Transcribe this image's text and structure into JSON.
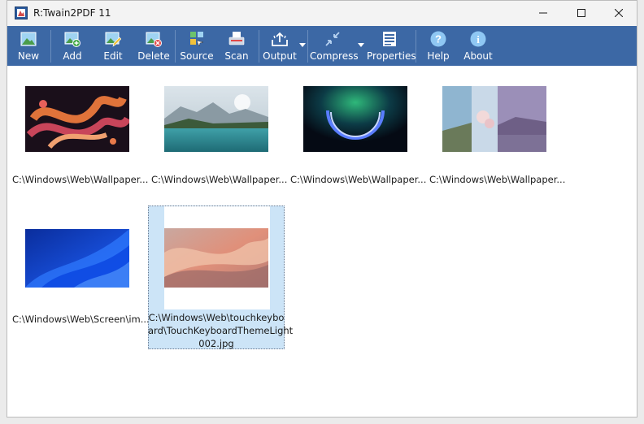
{
  "window": {
    "title": "R:Twain2PDF 11"
  },
  "titlebar_buttons": [
    "minimize",
    "maximize",
    "close"
  ],
  "toolbar": {
    "buttons": [
      {
        "label": "New",
        "icon": "new-image-icon"
      },
      {
        "label": "Add",
        "icon": "add-image-icon"
      },
      {
        "label": "Edit",
        "icon": "edit-image-icon"
      },
      {
        "label": "Delete",
        "icon": "delete-image-icon"
      },
      {
        "label": "Source",
        "icon": "source-icon"
      },
      {
        "label": "Scan",
        "icon": "scanner-icon"
      },
      {
        "label": "Output",
        "icon": "output-icon"
      },
      {
        "label": "Compress",
        "icon": "compress-icon"
      },
      {
        "label": "Properties",
        "icon": "properties-icon"
      },
      {
        "label": "Help",
        "icon": "help-icon"
      },
      {
        "label": "About",
        "icon": "about-icon"
      }
    ]
  },
  "images": [
    {
      "label": "C:\\Windows\\Web\\Wallpaper...",
      "selected": false
    },
    {
      "label": "C:\\Windows\\Web\\Wallpaper...",
      "selected": false
    },
    {
      "label": "C:\\Windows\\Web\\Wallpaper...",
      "selected": false
    },
    {
      "label": "C:\\Windows\\Web\\Wallpaper...",
      "selected": false
    },
    {
      "label": "C:\\Windows\\Web\\Screen\\im...",
      "selected": false
    },
    {
      "label_lines": [
        "C:\\Windows\\Web\\touchkeybo",
        "ard\\TouchKeyboardThemeLight",
        "002.jpg"
      ],
      "selected": true
    }
  ],
  "colors": {
    "toolbar": "#3c68a5",
    "selection": "#cce4f7",
    "titlebar": "#f3f3f3"
  }
}
